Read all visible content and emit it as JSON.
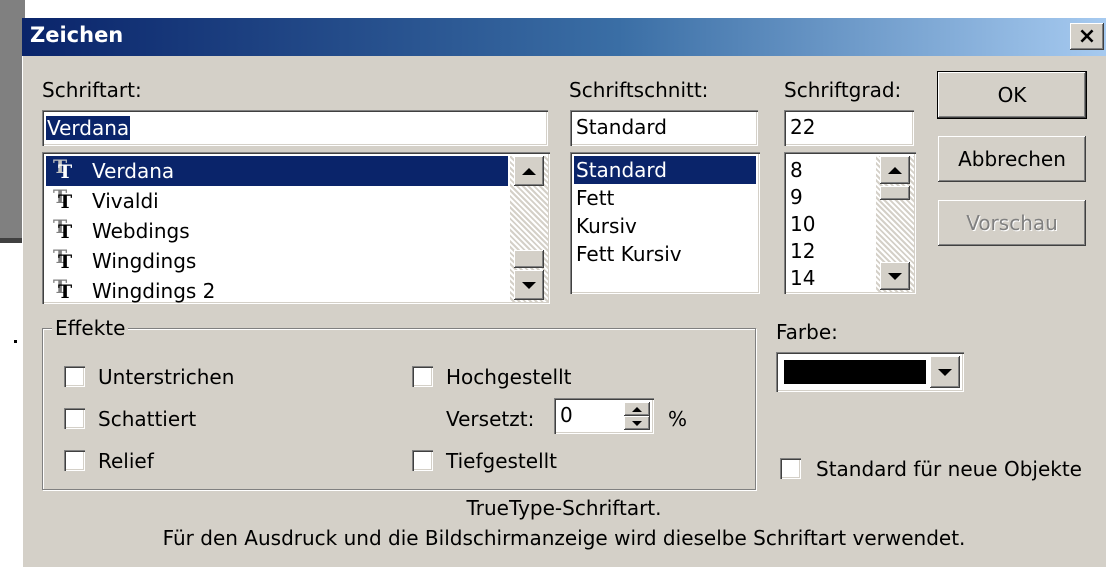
{
  "dialog": {
    "title": "Zeichen",
    "close_label": "×"
  },
  "font": {
    "label": "Schriftart:",
    "value": "Verdana",
    "items": [
      "Verdana",
      "Vivaldi",
      "Webdings",
      "Wingdings",
      "Wingdings 2"
    ],
    "selected": "Verdana",
    "item_icon": "truetype-font-icon",
    "icon_glyph": "T"
  },
  "style": {
    "label": "Schriftschnitt:",
    "value": "Standard",
    "items": [
      "Standard",
      "Fett",
      "Kursiv",
      "Fett Kursiv"
    ],
    "selected": "Standard"
  },
  "size": {
    "label": "Schriftgrad:",
    "value": "22",
    "items": [
      "8",
      "9",
      "10",
      "12",
      "14"
    ]
  },
  "buttons": {
    "ok": "OK",
    "cancel": "Abbrechen",
    "preview": "Vorschau"
  },
  "effects": {
    "legend": "Effekte",
    "underline": "Unterstrichen",
    "shadow": "Schattiert",
    "relief": "Relief",
    "superscript": "Hochgestellt",
    "offset_label": "Versetzt:",
    "offset_value": "0",
    "offset_unit": "%",
    "subscript": "Tiefgestellt"
  },
  "color": {
    "label": "Farbe:",
    "value_hex": "#000000"
  },
  "default_checkbox": "Standard für neue Objekte",
  "description": {
    "line1": "TrueType-Schriftart.",
    "line2": "Für den Ausdruck und die Bildschirmanzeige wird dieselbe Schriftart verwendet."
  },
  "colors": {
    "selection": "#0a246a",
    "face": "#d4d0c8"
  }
}
